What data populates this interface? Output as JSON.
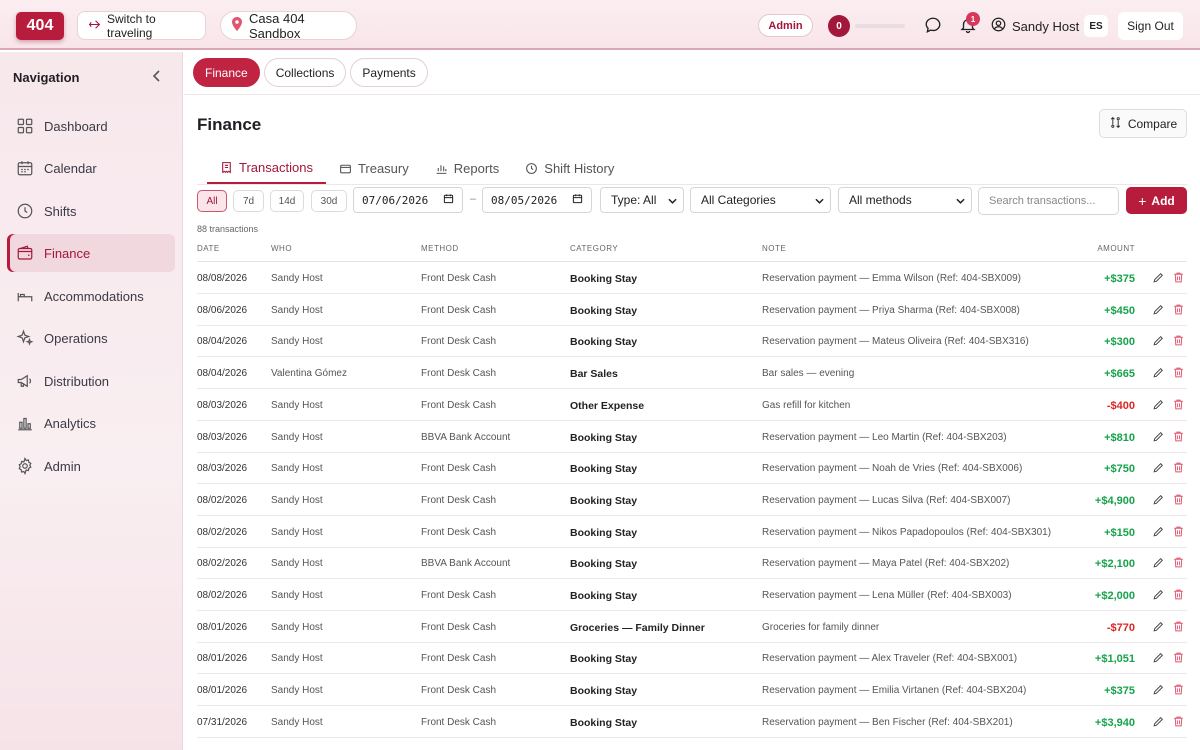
{
  "header": {
    "logo": "404",
    "switch_label": "Switch to traveling",
    "property_label": "Casa 404 Sandbox",
    "role_badge": "Admin",
    "level": "0",
    "level_progress": 0,
    "notification_count": "1",
    "user_name": "Sandy Host",
    "language": "ES",
    "signout_label": "Sign Out"
  },
  "sidebar": {
    "title": "Navigation",
    "items": [
      {
        "label": "Dashboard",
        "icon": "dashboard-icon"
      },
      {
        "label": "Calendar",
        "icon": "calendar-icon"
      },
      {
        "label": "Shifts",
        "icon": "clock-icon"
      },
      {
        "label": "Finance",
        "icon": "wallet-icon",
        "active": true
      },
      {
        "label": "Accommodations",
        "icon": "bed-icon"
      },
      {
        "label": "Operations",
        "icon": "sparkle-icon"
      },
      {
        "label": "Distribution",
        "icon": "megaphone-icon"
      },
      {
        "label": "Analytics",
        "icon": "bar-chart-icon"
      },
      {
        "label": "Admin",
        "icon": "gear-icon"
      }
    ]
  },
  "subtabs": [
    "Finance",
    "Collections",
    "Payments"
  ],
  "page": {
    "title": "Finance",
    "compare_label": "Compare"
  },
  "tabs": [
    "Transactions",
    "Treasury",
    "Reports",
    "Shift History"
  ],
  "filters": {
    "ranges": [
      "All",
      "7d",
      "14d",
      "30d"
    ],
    "date_from": "07/06/2026",
    "date_to": "08/05/2026",
    "date_separator": "–",
    "type": "Type: All",
    "category": "All Categories",
    "method": "All methods",
    "search_placeholder": "Search transactions...",
    "add_label": "Add"
  },
  "count_label": "88 transactions",
  "table": {
    "headers": [
      "DATE",
      "WHO",
      "METHOD",
      "CATEGORY",
      "NOTE",
      "AMOUNT"
    ],
    "rows": [
      {
        "date": "08/08/2026",
        "who": "Sandy Host",
        "method": "Front Desk Cash",
        "category": "Booking Stay",
        "note": "Reservation payment — Emma Wilson (Ref: 404-SBX009)",
        "amount": "+$375"
      },
      {
        "date": "08/06/2026",
        "who": "Sandy Host",
        "method": "Front Desk Cash",
        "category": "Booking Stay",
        "note": "Reservation payment — Priya Sharma (Ref: 404-SBX008)",
        "amount": "+$450"
      },
      {
        "date": "08/04/2026",
        "who": "Sandy Host",
        "method": "Front Desk Cash",
        "category": "Booking Stay",
        "note": "Reservation payment — Mateus Oliveira (Ref: 404-SBX316)",
        "amount": "+$300"
      },
      {
        "date": "08/04/2026",
        "who": "Valentina Gómez",
        "method": "Front Desk Cash",
        "category": "Bar Sales",
        "note": "Bar sales — evening",
        "amount": "+$665"
      },
      {
        "date": "08/03/2026",
        "who": "Sandy Host",
        "method": "Front Desk Cash",
        "category": "Other Expense",
        "note": "Gas refill for kitchen",
        "amount": "-$400"
      },
      {
        "date": "08/03/2026",
        "who": "Sandy Host",
        "method": "BBVA Bank Account",
        "category": "Booking Stay",
        "note": "Reservation payment — Leo Martin (Ref: 404-SBX203)",
        "amount": "+$810"
      },
      {
        "date": "08/03/2026",
        "who": "Sandy Host",
        "method": "Front Desk Cash",
        "category": "Booking Stay",
        "note": "Reservation payment — Noah de Vries (Ref: 404-SBX006)",
        "amount": "+$750"
      },
      {
        "date": "08/02/2026",
        "who": "Sandy Host",
        "method": "Front Desk Cash",
        "category": "Booking Stay",
        "note": "Reservation payment — Lucas Silva (Ref: 404-SBX007)",
        "amount": "+$4,900"
      },
      {
        "date": "08/02/2026",
        "who": "Sandy Host",
        "method": "Front Desk Cash",
        "category": "Booking Stay",
        "note": "Reservation payment — Nikos Papadopoulos (Ref: 404-SBX301)",
        "amount": "+$150"
      },
      {
        "date": "08/02/2026",
        "who": "Sandy Host",
        "method": "BBVA Bank Account",
        "category": "Booking Stay",
        "note": "Reservation payment — Maya Patel (Ref: 404-SBX202)",
        "amount": "+$2,100"
      },
      {
        "date": "08/02/2026",
        "who": "Sandy Host",
        "method": "Front Desk Cash",
        "category": "Booking Stay",
        "note": "Reservation payment — Lena Müller (Ref: 404-SBX003)",
        "amount": "+$2,000"
      },
      {
        "date": "08/01/2026",
        "who": "Sandy Host",
        "method": "Front Desk Cash",
        "category": "Groceries — Family Dinner",
        "note": "Groceries for family dinner",
        "amount": "-$770"
      },
      {
        "date": "08/01/2026",
        "who": "Sandy Host",
        "method": "Front Desk Cash",
        "category": "Booking Stay",
        "note": "Reservation payment — Alex Traveler (Ref: 404-SBX001)",
        "amount": "+$1,051"
      },
      {
        "date": "08/01/2026",
        "who": "Sandy Host",
        "method": "Front Desk Cash",
        "category": "Booking Stay",
        "note": "Reservation payment — Emilia Virtanen (Ref: 404-SBX204)",
        "amount": "+$375"
      },
      {
        "date": "07/31/2026",
        "who": "Sandy Host",
        "method": "Front Desk Cash",
        "category": "Booking Stay",
        "note": "Reservation payment — Ben Fischer (Ref: 404-SBX201)",
        "amount": "+$3,940"
      }
    ]
  },
  "colors": {
    "brand": "#b81c3c",
    "positive": "#16a34a",
    "negative": "#dc2626"
  }
}
